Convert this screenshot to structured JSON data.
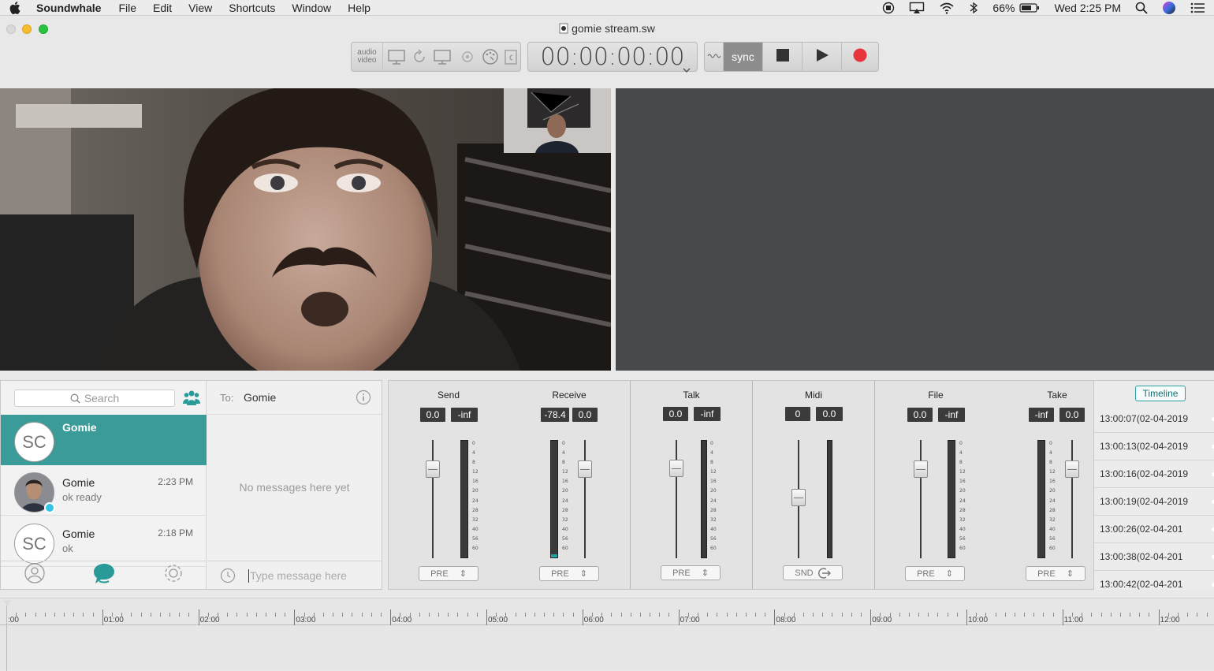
{
  "menubar": {
    "app": "Soundwhale",
    "items": [
      "File",
      "Edit",
      "View",
      "Shortcuts",
      "Window",
      "Help"
    ],
    "battery": "66%",
    "clock": "Wed 2:25 PM"
  },
  "window": {
    "title": "gomie stream.sw"
  },
  "toolbar": {
    "audio_label": "audio",
    "video_label": "video",
    "timecode": "00:00:00:00",
    "sync_label": "sync"
  },
  "chat": {
    "search_placeholder": "Search",
    "contacts": [
      {
        "name": "Gomie",
        "initials": "SC",
        "message": "",
        "time": ""
      },
      {
        "name": "Gomie",
        "initials": "",
        "message": "ok ready",
        "time": "2:23 PM"
      },
      {
        "name": "Gomie",
        "initials": "SC",
        "message": "ok",
        "time": "2:18 PM"
      }
    ],
    "to_label": "To:",
    "to_name": "Gomie",
    "empty_text": "No messages here yet",
    "input_placeholder": "Type message here"
  },
  "mixer": {
    "strips": [
      {
        "name": "Send",
        "v1": "0.0",
        "v2": "-inf",
        "button": "PRE"
      },
      {
        "name": "Receive",
        "v1": "-78.4",
        "v2": "0.0",
        "button": "PRE"
      },
      {
        "name": "Talk",
        "v1": "0.0",
        "v2": "-inf",
        "button": "PRE"
      },
      {
        "name": "Midi",
        "v1": "0",
        "v2": "0.0",
        "button": "SND"
      },
      {
        "name": "File",
        "v1": "0.0",
        "v2": "-inf",
        "button": "PRE"
      },
      {
        "name": "Take",
        "v1": "-inf",
        "v2": "0.0",
        "button": "PRE"
      }
    ],
    "scale": [
      "0",
      "4",
      "8",
      "12",
      "16",
      "20",
      "24",
      "28",
      "32",
      "40",
      "56",
      "60"
    ]
  },
  "timeline": {
    "button": "Timeline",
    "items": [
      "13:00:07(02-04-2019",
      "13:00:13(02-04-2019",
      "13:00:16(02-04-2019",
      "13:00:19(02-04-2019",
      "13:00:26(02-04-201",
      "13:00:38(02-04-201",
      "13:00:42(02-04-201"
    ]
  },
  "ruler": {
    "labels": [
      ":00",
      "01:00",
      "02:00",
      "03:00",
      "04:00",
      "05:00",
      "06:00",
      "07:00",
      "08:00",
      "09:00",
      "10:00",
      "11:00",
      "12:00"
    ]
  },
  "colors": {
    "accent": "#3a9b99",
    "record": "#e8343d",
    "dark_panel": "#48494b"
  }
}
